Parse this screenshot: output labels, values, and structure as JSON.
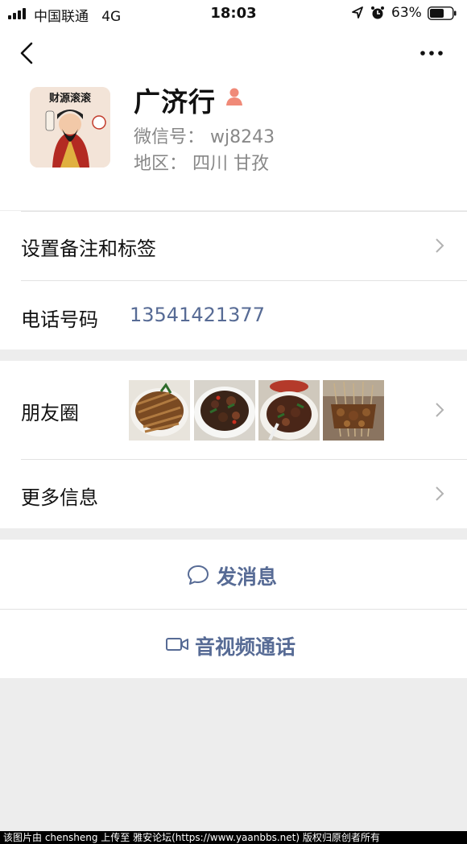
{
  "status_bar": {
    "carrier": "中国联通",
    "network": "4G",
    "time": "18:03",
    "battery_percent": "63%",
    "battery_level": 0.63
  },
  "nav": {
    "back_icon": "chevron-left-icon",
    "more_icon": "more-dots-icon"
  },
  "profile": {
    "name": "广济行",
    "gender_icon": "user-female-icon",
    "gender_color": "#fa5151",
    "wechat_id_label": "微信号：",
    "wechat_id": "wj8243",
    "region_label": "地区：",
    "region": "四川 甘孜",
    "avatar_text": "财源滚滚"
  },
  "rows": {
    "remark_label": "设置备注和标签",
    "phone_label": "电话号码",
    "phone_number": "13541421377",
    "moments_label": "朋友圈",
    "more_info_label": "更多信息"
  },
  "actions": {
    "message_label": "发消息",
    "message_icon": "chat-bubble-icon",
    "call_label": "音视频通话",
    "call_icon": "video-camera-icon"
  },
  "colors": {
    "link": "#576b95",
    "background": "#ededed"
  },
  "watermark": "该图片由 chensheng 上传至 雅安论坛(https://www.yaanbbs.net) 版权归原创者所有"
}
